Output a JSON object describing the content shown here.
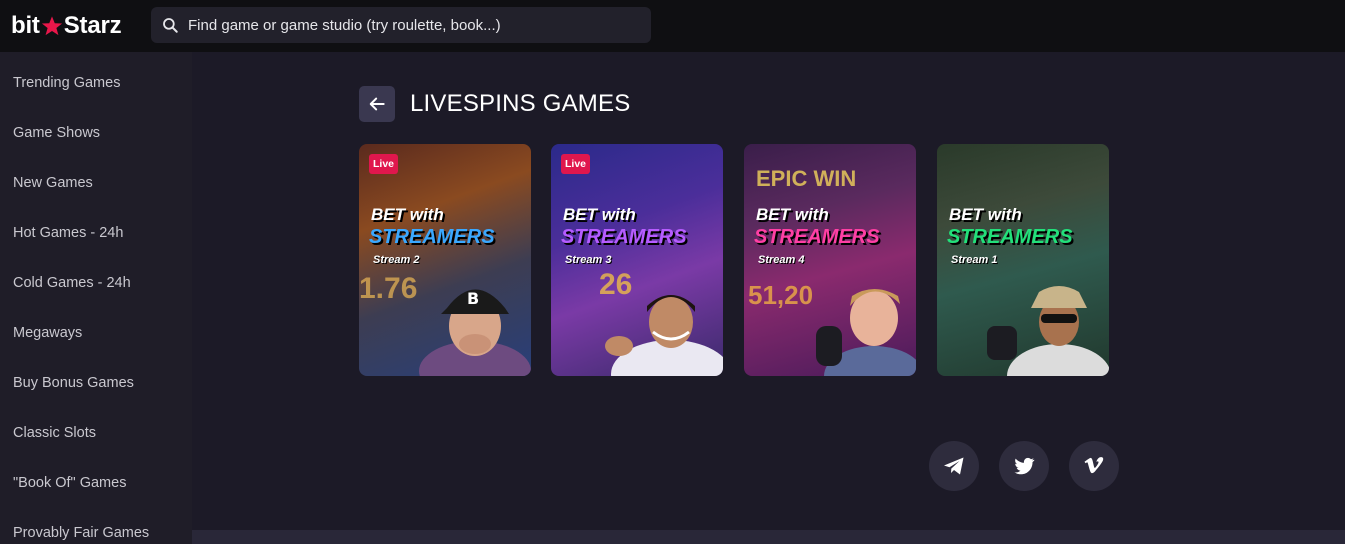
{
  "header": {
    "logo_left": "bit",
    "logo_right": "Starz",
    "search_placeholder": "Find game or game studio (try roulette, book...)"
  },
  "sidebar": {
    "items": [
      {
        "label": "Trending Games"
      },
      {
        "label": "Game Shows"
      },
      {
        "label": "New Games"
      },
      {
        "label": "Hot Games - 24h"
      },
      {
        "label": "Cold Games - 24h"
      },
      {
        "label": "Megaways"
      },
      {
        "label": "Buy Bonus Games"
      },
      {
        "label": "Classic Slots"
      },
      {
        "label": "\"Book Of\" Games"
      },
      {
        "label": "Provably Fair Games"
      }
    ]
  },
  "main": {
    "title": "LIVESPINS GAMES",
    "cards": [
      {
        "badge": "Live",
        "line1": "BET with",
        "line2": "STREAMERS",
        "line3": "Stream 2",
        "bg_text": "1.76",
        "accent": "#3aa8ff"
      },
      {
        "badge": "Live",
        "line1": "BET with",
        "line2": "STREAMERS",
        "line3": "Stream 3",
        "bg_text": "26",
        "accent": "#a855f7"
      },
      {
        "badge": "",
        "line1": "BET with",
        "line2": "STREAMERS",
        "line3": "Stream 4",
        "bg_text": "51,20",
        "accent": "#ff3fa4",
        "top_text": "EPIC WIN"
      },
      {
        "badge": "",
        "line1": "BET with",
        "line2": "STREAMERS",
        "line3": "Stream 1",
        "bg_text": "",
        "accent": "#22e07a"
      }
    ]
  },
  "social": {
    "icons": [
      "telegram-icon",
      "twitter-icon",
      "vimeo-icon"
    ]
  },
  "colors": {
    "topbar": "#0f0f12",
    "sidebar": "#1f1d28",
    "main": "#1c1a27",
    "live_badge": "#e0174d",
    "star": "#e8174a"
  }
}
